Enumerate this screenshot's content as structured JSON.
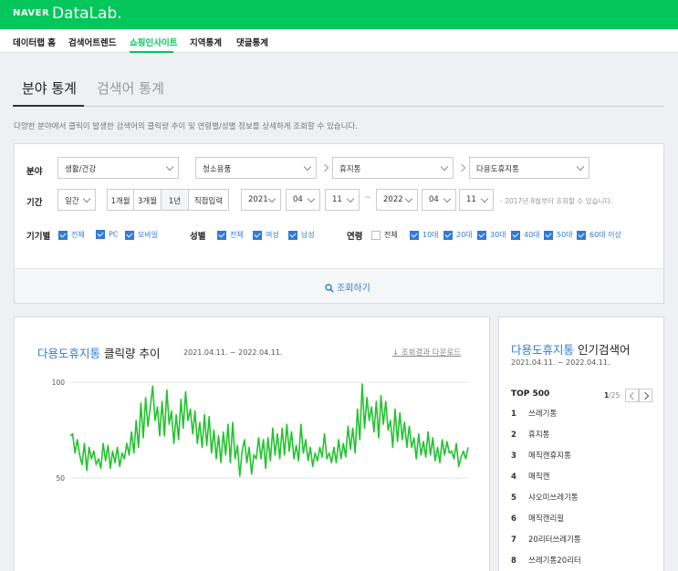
{
  "brand": {
    "naver": "NAVER",
    "datalab": "DataLab."
  },
  "gnb": [
    "데이터랩 홈",
    "검색어트렌드",
    "쇼핑인사이트",
    "지역통계",
    "댓글통계"
  ],
  "tabs": [
    "분야 통계",
    "검색어 통계"
  ],
  "description": "다양한 분야에서 클릭이 발생한 검색어의 클릭량 추이 및 연령별/성별 정보를 상세하게 조회할 수 있습니다.",
  "filter": {
    "category_label": "분야",
    "categories": [
      "생활/건강",
      "청소용품",
      "휴지통",
      "다용도휴지통"
    ],
    "period_label": "기간",
    "period_unit": "일간",
    "period_buttons": [
      "1개월",
      "3개월",
      "1년",
      "직접입력"
    ],
    "start": {
      "year": "2021",
      "month": "04",
      "day": "11"
    },
    "end": {
      "year": "2022",
      "month": "04",
      "day": "11"
    },
    "dash": "~",
    "period_note": "- 2017년 8월부터 조회할 수 있습니다.",
    "device_label": "기기별",
    "devices": [
      "전체",
      "PC",
      "모바일"
    ],
    "gender_label": "성별",
    "genders": [
      "전체",
      "여성",
      "남성"
    ],
    "age_label": "연령",
    "ages": [
      "전체",
      "10대",
      "20대",
      "30대",
      "40대",
      "50대",
      "60대 이상"
    ],
    "search_button": "조회하기"
  },
  "trend_panel": {
    "keyword": "다용도휴지통",
    "title_rest": "클릭량 추이",
    "date_range": "2021.04.11. ~ 2022.04.11.",
    "download": "조회결과 다운로드"
  },
  "chart_data": {
    "type": "line",
    "title": "다용도휴지통 클릭량 추이",
    "ylim": [
      50,
      100
    ],
    "y_ticks": [
      "100",
      "50"
    ],
    "line_color": "#22c32e",
    "series": [
      {
        "values": [
          72,
          73,
          63,
          70,
          62,
          57,
          68,
          54,
          66,
          60,
          64,
          57,
          60,
          55,
          68,
          59,
          67,
          55,
          64,
          58,
          66,
          56,
          63,
          60,
          68,
          62,
          74,
          63,
          80,
          66,
          89,
          71,
          92,
          77,
          87,
          98,
          80,
          87,
          72,
          90,
          72,
          96,
          78,
          85,
          68,
          83,
          70,
          91,
          76,
          95,
          80,
          86,
          73,
          85,
          68,
          79,
          66,
          83,
          67,
          82,
          63,
          75,
          60,
          72,
          58,
          74,
          62,
          78,
          58,
          79,
          60,
          67,
          51,
          64,
          70,
          58,
          66,
          52,
          62,
          60,
          71,
          60,
          70,
          55,
          71,
          59,
          76,
          62,
          73,
          60,
          76,
          62,
          78,
          64,
          74,
          60,
          67,
          59,
          78,
          63,
          70,
          59,
          66,
          56,
          63,
          59,
          66,
          61,
          73,
          60,
          63,
          58,
          66,
          58,
          70,
          60,
          68,
          61,
          77,
          65,
          76,
          63,
          86,
          70,
          99,
          76,
          92,
          80,
          87,
          74,
          90,
          71,
          93,
          78,
          90,
          75,
          80,
          66,
          86,
          69,
          84,
          70,
          79,
          66,
          77,
          66,
          71,
          60,
          73,
          62,
          69,
          61,
          74,
          62,
          71,
          59,
          66,
          58,
          70,
          62,
          69,
          63,
          64,
          60,
          68,
          56,
          61,
          64,
          60,
          66
        ]
      }
    ]
  },
  "top_panel": {
    "keyword": "다용도휴지통",
    "title_rest": "인기검색어",
    "date_range": "2021.04.11. ~ 2022.04.11.",
    "top_label": "TOP 500",
    "page": "1",
    "page_total": "/25",
    "items": [
      {
        "rank": "1",
        "term": "쓰레기통"
      },
      {
        "rank": "2",
        "term": "휴지통"
      },
      {
        "rank": "3",
        "term": "매직캔휴지통"
      },
      {
        "rank": "4",
        "term": "매직캔"
      },
      {
        "rank": "5",
        "term": "샤오미쓰레기통"
      },
      {
        "rank": "6",
        "term": "매직캔리필"
      },
      {
        "rank": "7",
        "term": "20리터쓰레기통"
      },
      {
        "rank": "8",
        "term": "쓰레기통20리터"
      }
    ]
  },
  "colors": {
    "brand": "#03c75a",
    "accent": "#2f7bd8",
    "chart": "#22c32e"
  }
}
